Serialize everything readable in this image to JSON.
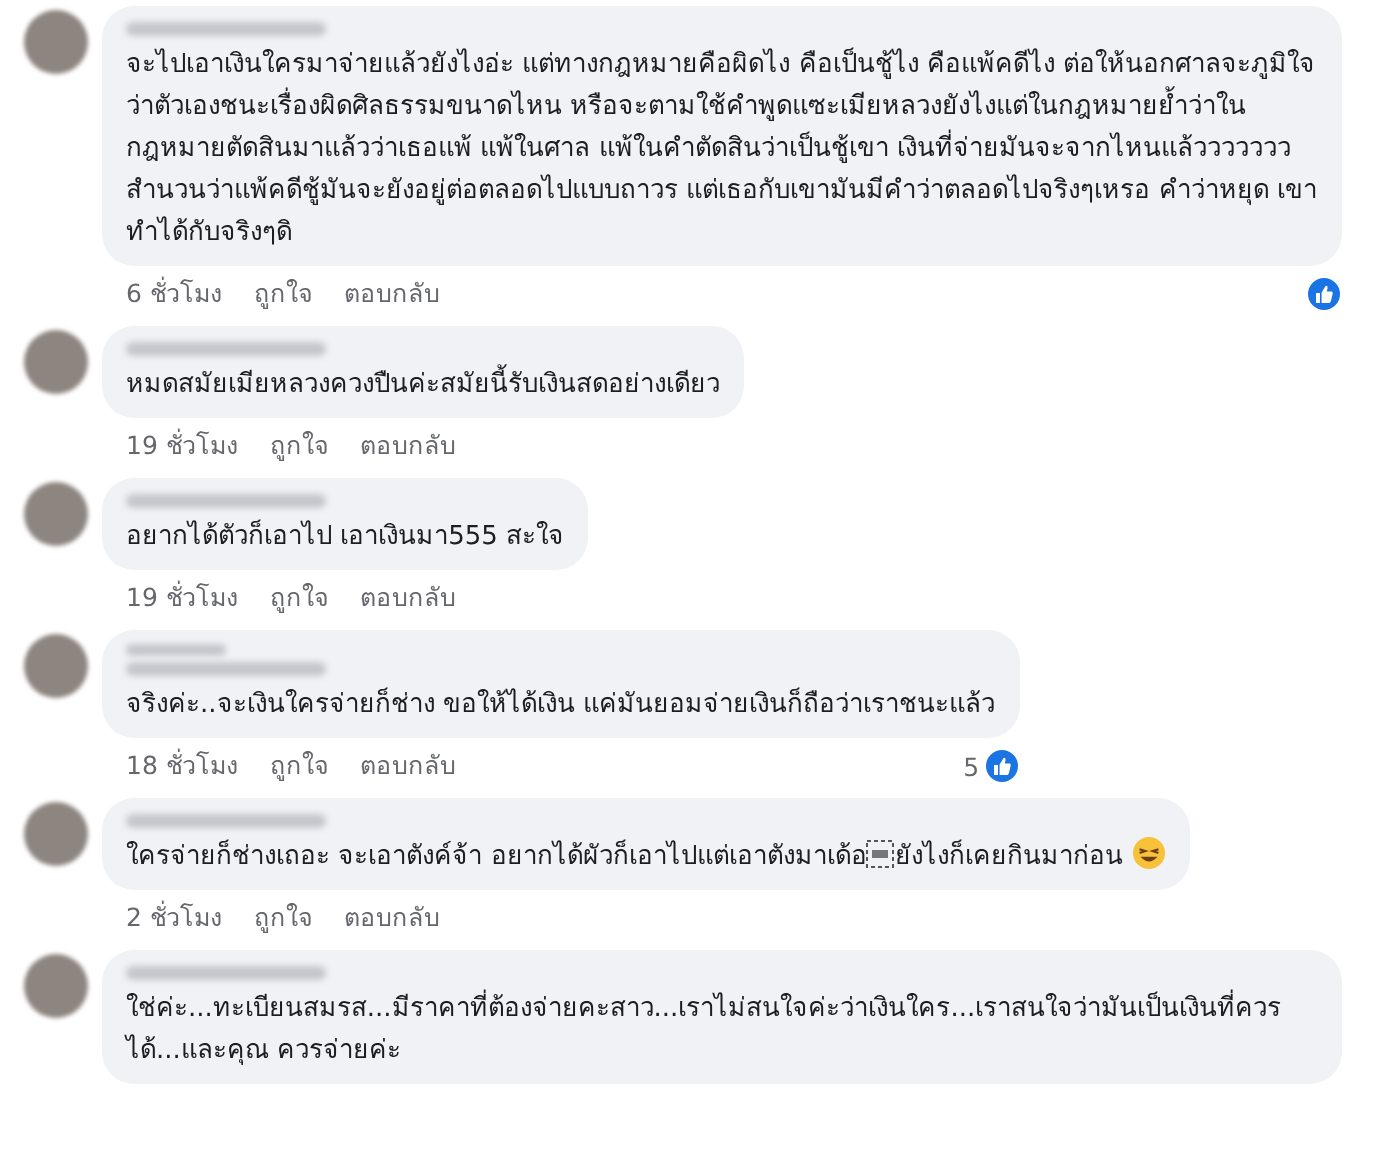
{
  "comments": [
    {
      "text": "จะไปเอาเงินใครมาจ่ายแล้วยังไงอ่ะ แต่ทางกฎหมายคือผิดไง คือเป็นชู้ไง คือแพ้คดีไง ต่อให้นอกศาลจะภูมิใจว่าตัวเองชนะเรื่องผิดศิลธรรมขนาดไหน หรือจะตามใช้คำพูดแซะเมียหลวงยังไงแต่ในกฎหมายย้ำว่าในกฎหมายตัดสินมาแล้วว่าเธอแพ้ แพ้ในศาล แพ้ในคำตัดสินว่าเป็นชู้เขา เงินที่จ่ายมันจะจากไหนแล้ววววววว สำนวนว่าแพ้คดีชู้มันจะยังอยู่ต่อตลอดไปแบบถาวร แต่เธอกับเขามันมีคำว่าตลอดไปจริงๆเหรอ คำว่าหยุด เขาทำได้กับจริงๆดิ",
      "time": "6 ชั่วโมง",
      "like": "ถูกใจ",
      "reply": "ตอบกลับ",
      "reacted": true
    },
    {
      "text": "หมดสมัยเมียหลวงควงปืนค่ะสมัยนี้รับเงินสดอย่างเดียว",
      "time": "19 ชั่วโมง",
      "like": "ถูกใจ",
      "reply": "ตอบกลับ"
    },
    {
      "text": "อยากได้ตัวก็เอาไป เอาเงินมา555 สะใจ",
      "time": "19 ชั่วโมง",
      "like": "ถูกใจ",
      "reply": "ตอบกลับ"
    },
    {
      "badge": true,
      "text": "จริงค่ะ..จะเงินใครจ่ายก็ช่าง ขอให้ได้เงิน แค่มันยอมจ่ายเงินก็ถือว่าเราชนะแล้ว",
      "time": "18 ชั่วโมง",
      "like": "ถูกใจ",
      "reply": "ตอบกลับ",
      "reacted": true,
      "reaction_count": "5"
    },
    {
      "text": "ใครจ่ายก็ช่างเถอะ จะเอาตังค์จ้า อยากได้ผัวก็เอาไปแต่เอาตังมาเด้อ",
      "object_icon": true,
      "text_after": "ยังไงก็เคยกินมาก่อน",
      "emoji": true,
      "time": "2 ชั่วโมง",
      "like": "ถูกใจ",
      "reply": "ตอบกลับ"
    },
    {
      "text": "ใช่ค่ะ...ทะเบียนสมรส...มีราคาที่ต้องจ่ายคะสาว...เราไม่สนใจค่ะว่าเงินใคร...เราสนใจว่ามันเป็นเงินที่ควรได้...และคุณ ควรจ่ายค่ะ"
    }
  ]
}
